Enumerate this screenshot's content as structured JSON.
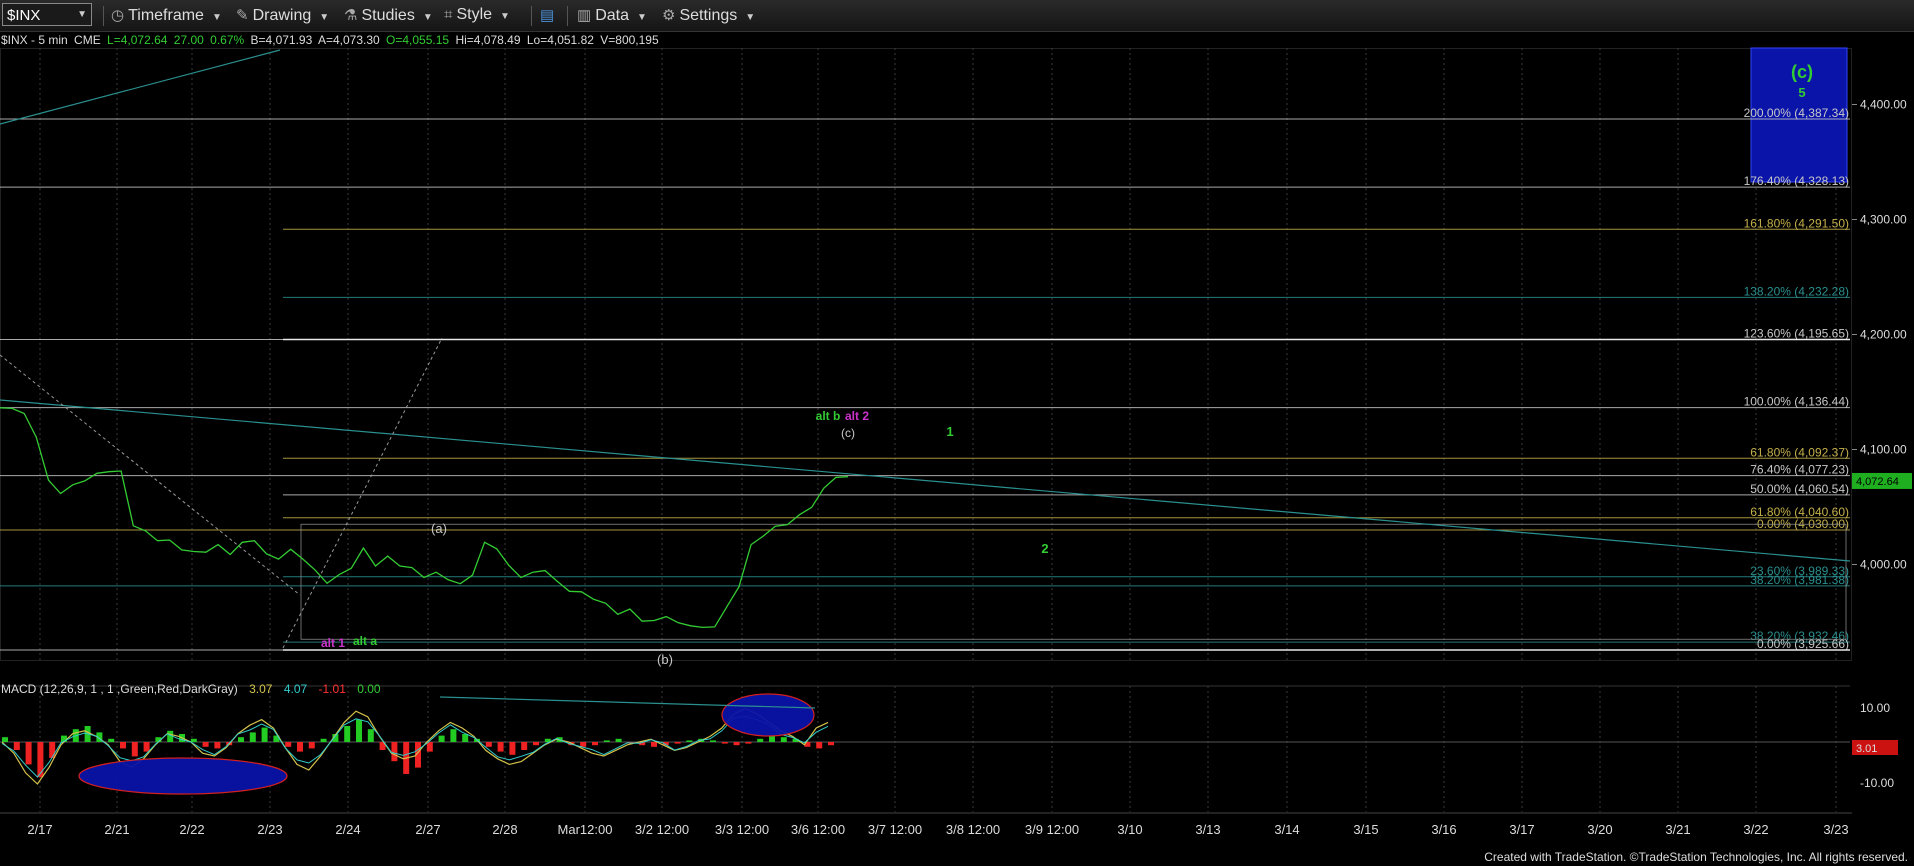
{
  "toolbar": {
    "symbol": "$INX",
    "timeframe": "Timeframe",
    "drawing": "Drawing",
    "studies": "Studies",
    "style": "Style",
    "data": "Data",
    "settings": "Settings"
  },
  "info": {
    "symbol": "$INX - 5 min",
    "exchange": "CME",
    "last": "L=4,072.64",
    "change": "27.00",
    "pct": "0.67%",
    "bid": "B=4,071.93",
    "ask": "A=4,073.30",
    "open": "O=4,055.15",
    "high": "Hi=4,078.49",
    "low": "Lo=4,051.82",
    "volume": "V=800,195"
  },
  "macd": {
    "label": "MACD (12,26,9, 1 , 1 ,Green,Red,DarkGray)",
    "v1": "3.07",
    "v2": "4.07",
    "v3": "-1.01",
    "v4": "0.00"
  },
  "footer": "Created with TradeStation. ©TradeStation Technologies, Inc. All rights reserved.",
  "colors": {
    "price": "#33cc33",
    "fib": "#c8c8c8",
    "teal": "#2b8f8f",
    "gold": "#c4b04a",
    "purple": "#cc33cc",
    "target_box": "#0a14a8"
  },
  "chart_data": {
    "type": "line",
    "title": "$INX - 5 min",
    "y_ticks": [
      "4,400.00",
      "4,300.00",
      "4,200.00",
      "4,100.00",
      "4,000.00"
    ],
    "ylim": [
      3900,
      4440
    ],
    "x_ticks": [
      "2/17",
      "2/21",
      "2/22",
      "2/23",
      "2/24",
      "2/27",
      "2/28",
      "Mar12:00",
      "3/2 12:00",
      "3/3 12:00",
      "3/6 12:00",
      "3/7 12:00",
      "3/8 12:00",
      "3/9 12:00",
      "3/10",
      "3/13",
      "3/14",
      "3/15",
      "3/16",
      "3/17",
      "3/20",
      "3/21",
      "3/22",
      "3/23"
    ],
    "last_price_label": "4,072.64",
    "series": [
      {
        "values": [
          4135,
          4137,
          4130,
          4112,
          4072,
          4063,
          4068,
          4074,
          4078,
          4082,
          4080,
          4035,
          4028,
          4022,
          4020,
          4014,
          4010,
          4012,
          4016,
          4010,
          4018,
          4022,
          4008,
          4006,
          4012,
          4006,
          3994,
          3985,
          3990,
          3998,
          4013,
          4000,
          4006,
          4000,
          3996,
          3990,
          3992,
          3988,
          3982,
          3992,
          4018,
          4015,
          3998,
          3990,
          3992,
          3996,
          3984,
          3978,
          3975,
          3971,
          3965,
          3958,
          3960,
          3952,
          3950,
          3956,
          3948,
          3948,
          3944,
          3947,
          3962,
          3982,
          4016,
          4026,
          4032,
          4036,
          4042,
          4051,
          4065,
          4077,
          4075
        ]
      }
    ],
    "fib_levels": [
      {
        "label": "200.00% (4,387.34)",
        "value": 4387.34,
        "color": "#c8c8c8"
      },
      {
        "label": "176.40% (4,328.13)",
        "value": 4328.13,
        "color": "#c8c8c8"
      },
      {
        "label": "161.80% (4,291.50)",
        "value": 4291.5,
        "color": "#c4b04a"
      },
      {
        "label": "138.20% (4,232.28)",
        "value": 4232.28,
        "color": "#2b8f8f"
      },
      {
        "label": "123.60% (4,195.65)",
        "value": 4195.65,
        "color": "#c8c8c8"
      },
      {
        "label": "100.00% (4,136.44)",
        "value": 4136.44,
        "color": "#c8c8c8"
      },
      {
        "label": "61.80% (4,092.37)",
        "value": 4092.37,
        "color": "#c4b04a"
      },
      {
        "label": "76.40% (4,077.23)",
        "value": 4077.23,
        "color": "#c8c8c8"
      },
      {
        "label": "50.00% (4,060.54)",
        "value": 4060.54,
        "color": "#c8c8c8"
      },
      {
        "label": "61.80% (4,040.60)",
        "value": 4040.6,
        "color": "#c4b04a"
      },
      {
        "label": "0.00% (4,030.00)",
        "value": 4030.0,
        "color": "#c4b04a"
      },
      {
        "label": "23.60% (3,989.33)",
        "value": 3989.33,
        "color": "#2b8f8f"
      },
      {
        "label": "38.20% (3,981.38)",
        "value": 3981.38,
        "color": "#2b8f8f"
      },
      {
        "label": "38.20% (3,932.46)",
        "value": 3932.46,
        "color": "#2b8f8f"
      },
      {
        "label": "0.00% (3,925.66)",
        "value": 3925.66,
        "color": "#c8c8c8"
      }
    ],
    "annotations": [
      {
        "text": "(c)",
        "color": "#33cc33"
      },
      {
        "text": "5",
        "color": "#33cc33"
      },
      {
        "text": "alt b",
        "color": "#33cc33"
      },
      {
        "text": "alt 2",
        "color": "#cc33cc"
      },
      {
        "text": "(c)",
        "color": "#c8c8c8"
      },
      {
        "text": "1",
        "color": "#33cc33"
      },
      {
        "text": "2",
        "color": "#33cc33"
      },
      {
        "text": "(a)",
        "color": "#c8c8c8"
      },
      {
        "text": "(b)",
        "color": "#c8c8c8"
      },
      {
        "text": "alt 1",
        "color": "#cc33cc"
      },
      {
        "text": "alt a",
        "color": "#33cc33"
      }
    ],
    "macd_ticks": [
      "10.00",
      "-10.00"
    ],
    "macd_value_label": "3.01",
    "grid": true
  }
}
